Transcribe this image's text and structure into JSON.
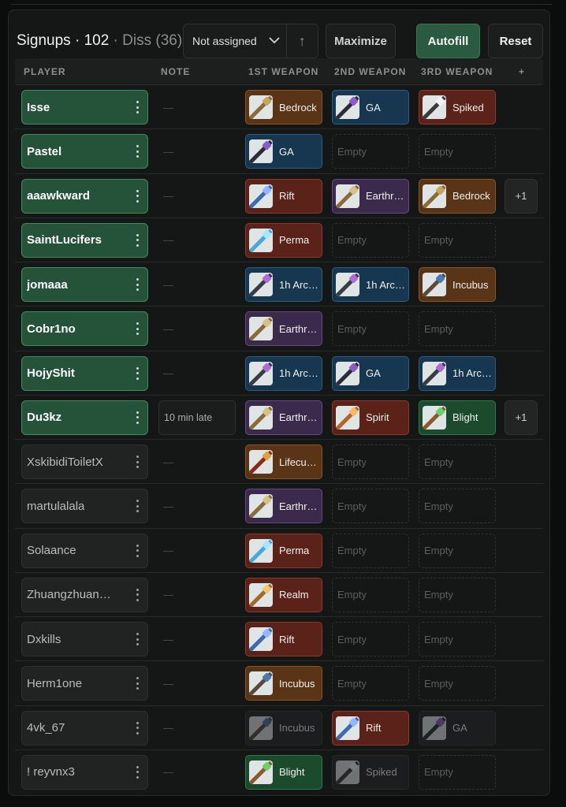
{
  "header": {
    "title_label": "Signups",
    "signup_count": "102",
    "diss_label": "Diss (36)",
    "assign_select_value": "Not assigned",
    "sort_label": "↑",
    "maximize_label": "Maximize",
    "autofill_label": "Autofill",
    "reset_label": "Reset"
  },
  "columns": [
    "PLAYER",
    "NOTE",
    "1ST WEAPON",
    "2ND WEAPON",
    "3RD WEAPON",
    "+"
  ],
  "colors": {
    "accent_green": "#2a5a40",
    "row_active": "#24533a"
  },
  "rows": [
    {
      "player": "Isse",
      "note": "—",
      "weapons": [
        {
          "name": "Bedrock",
          "color": "brown",
          "icon": "bedrock-icon"
        },
        {
          "name": "GA",
          "color": "blue",
          "icon": "ga-icon"
        },
        {
          "name": "Spiked",
          "color": "red",
          "icon": "spiked-icon"
        }
      ]
    },
    {
      "player": "Pastel",
      "note": "—",
      "weapons": [
        {
          "name": "GA",
          "color": "blue",
          "icon": "ga-icon"
        },
        {
          "name": "Empty"
        },
        {
          "name": "Empty"
        }
      ]
    },
    {
      "player": "aaawkward",
      "note": "—",
      "extra": "+1",
      "weapons": [
        {
          "name": "Rift",
          "color": "red",
          "icon": "rift-icon"
        },
        {
          "name": "Earthr…",
          "color": "purple",
          "icon": "earthrune-icon"
        },
        {
          "name": "Bedrock",
          "color": "brown",
          "icon": "bedrock-icon"
        }
      ]
    },
    {
      "player": "SaintLucifers",
      "note": "—",
      "weapons": [
        {
          "name": "Perma",
          "color": "red",
          "icon": "perma-icon"
        },
        {
          "name": "Empty"
        },
        {
          "name": "Empty"
        }
      ]
    },
    {
      "player": "jomaaa",
      "note": "—",
      "weapons": [
        {
          "name": "1h Arc…",
          "color": "blue",
          "icon": "arcane-icon"
        },
        {
          "name": "1h Arc…",
          "color": "blue",
          "icon": "arcane-icon"
        },
        {
          "name": "Incubus",
          "color": "brown",
          "icon": "incubus-icon"
        }
      ]
    },
    {
      "player": "Cobr1no",
      "note": "—",
      "weapons": [
        {
          "name": "Earthr…",
          "color": "purple",
          "icon": "earthrune-icon"
        },
        {
          "name": "Empty"
        },
        {
          "name": "Empty"
        }
      ]
    },
    {
      "player": "HojyShit",
      "note": "—",
      "weapons": [
        {
          "name": "1h Arc…",
          "color": "blue",
          "icon": "arcane-icon"
        },
        {
          "name": "GA",
          "color": "blue",
          "icon": "ga-icon"
        },
        {
          "name": "1h Arc…",
          "color": "blue",
          "icon": "arcane-icon"
        }
      ]
    },
    {
      "player": "Du3kz",
      "note": "10 min late",
      "extra": "+1",
      "weapons": [
        {
          "name": "Earthr…",
          "color": "purple",
          "icon": "earthrune-icon"
        },
        {
          "name": "Spirit",
          "color": "red",
          "icon": "spirit-icon"
        },
        {
          "name": "Blight",
          "color": "green",
          "icon": "blight-icon"
        }
      ]
    },
    {
      "player": "XskibidiToiletX",
      "note": "—",
      "weapons": [
        {
          "name": "Lifecu…",
          "color": "brown",
          "icon": "lifecurse-icon"
        },
        {
          "name": "Empty"
        },
        {
          "name": "Empty"
        }
      ]
    },
    {
      "player": "martulalala",
      "note": "—",
      "weapons": [
        {
          "name": "Earthr…",
          "color": "purple",
          "icon": "earthrune-icon"
        },
        {
          "name": "Empty"
        },
        {
          "name": "Empty"
        }
      ]
    },
    {
      "player": "Solaance",
      "note": "—",
      "weapons": [
        {
          "name": "Perma",
          "color": "red",
          "icon": "perma-icon"
        },
        {
          "name": "Empty"
        },
        {
          "name": "Empty"
        }
      ]
    },
    {
      "player": "Zhuangzhuan…",
      "note": "—",
      "weapons": [
        {
          "name": "Realm",
          "color": "red",
          "icon": "realm-icon"
        },
        {
          "name": "Empty"
        },
        {
          "name": "Empty"
        }
      ]
    },
    {
      "player": "Dxkills",
      "note": "—",
      "weapons": [
        {
          "name": "Rift",
          "color": "red",
          "icon": "rift-icon"
        },
        {
          "name": "Empty"
        },
        {
          "name": "Empty"
        }
      ]
    },
    {
      "player": "Herm1one",
      "note": "—",
      "weapons": [
        {
          "name": "Incubus",
          "color": "brown",
          "icon": "incubus-icon"
        },
        {
          "name": "Empty"
        },
        {
          "name": "Empty"
        }
      ]
    },
    {
      "player": "4vk_67",
      "note": "—",
      "weapons": [
        {
          "name": "Incubus",
          "color": "grey",
          "icon": "incubus-icon",
          "dim": true
        },
        {
          "name": "Rift",
          "color": "red",
          "icon": "rift-icon"
        },
        {
          "name": "GA",
          "color": "grey",
          "icon": "ga-icon",
          "dim": true
        }
      ]
    },
    {
      "player": "! reyvnx3",
      "note": "—",
      "weapons": [
        {
          "name": "Blight",
          "color": "green",
          "icon": "blight-icon"
        },
        {
          "name": "Spiked",
          "color": "grey",
          "icon": "spiked-icon",
          "dim": true
        },
        {
          "name": "Empty"
        }
      ]
    }
  ],
  "active_rows": 8
}
